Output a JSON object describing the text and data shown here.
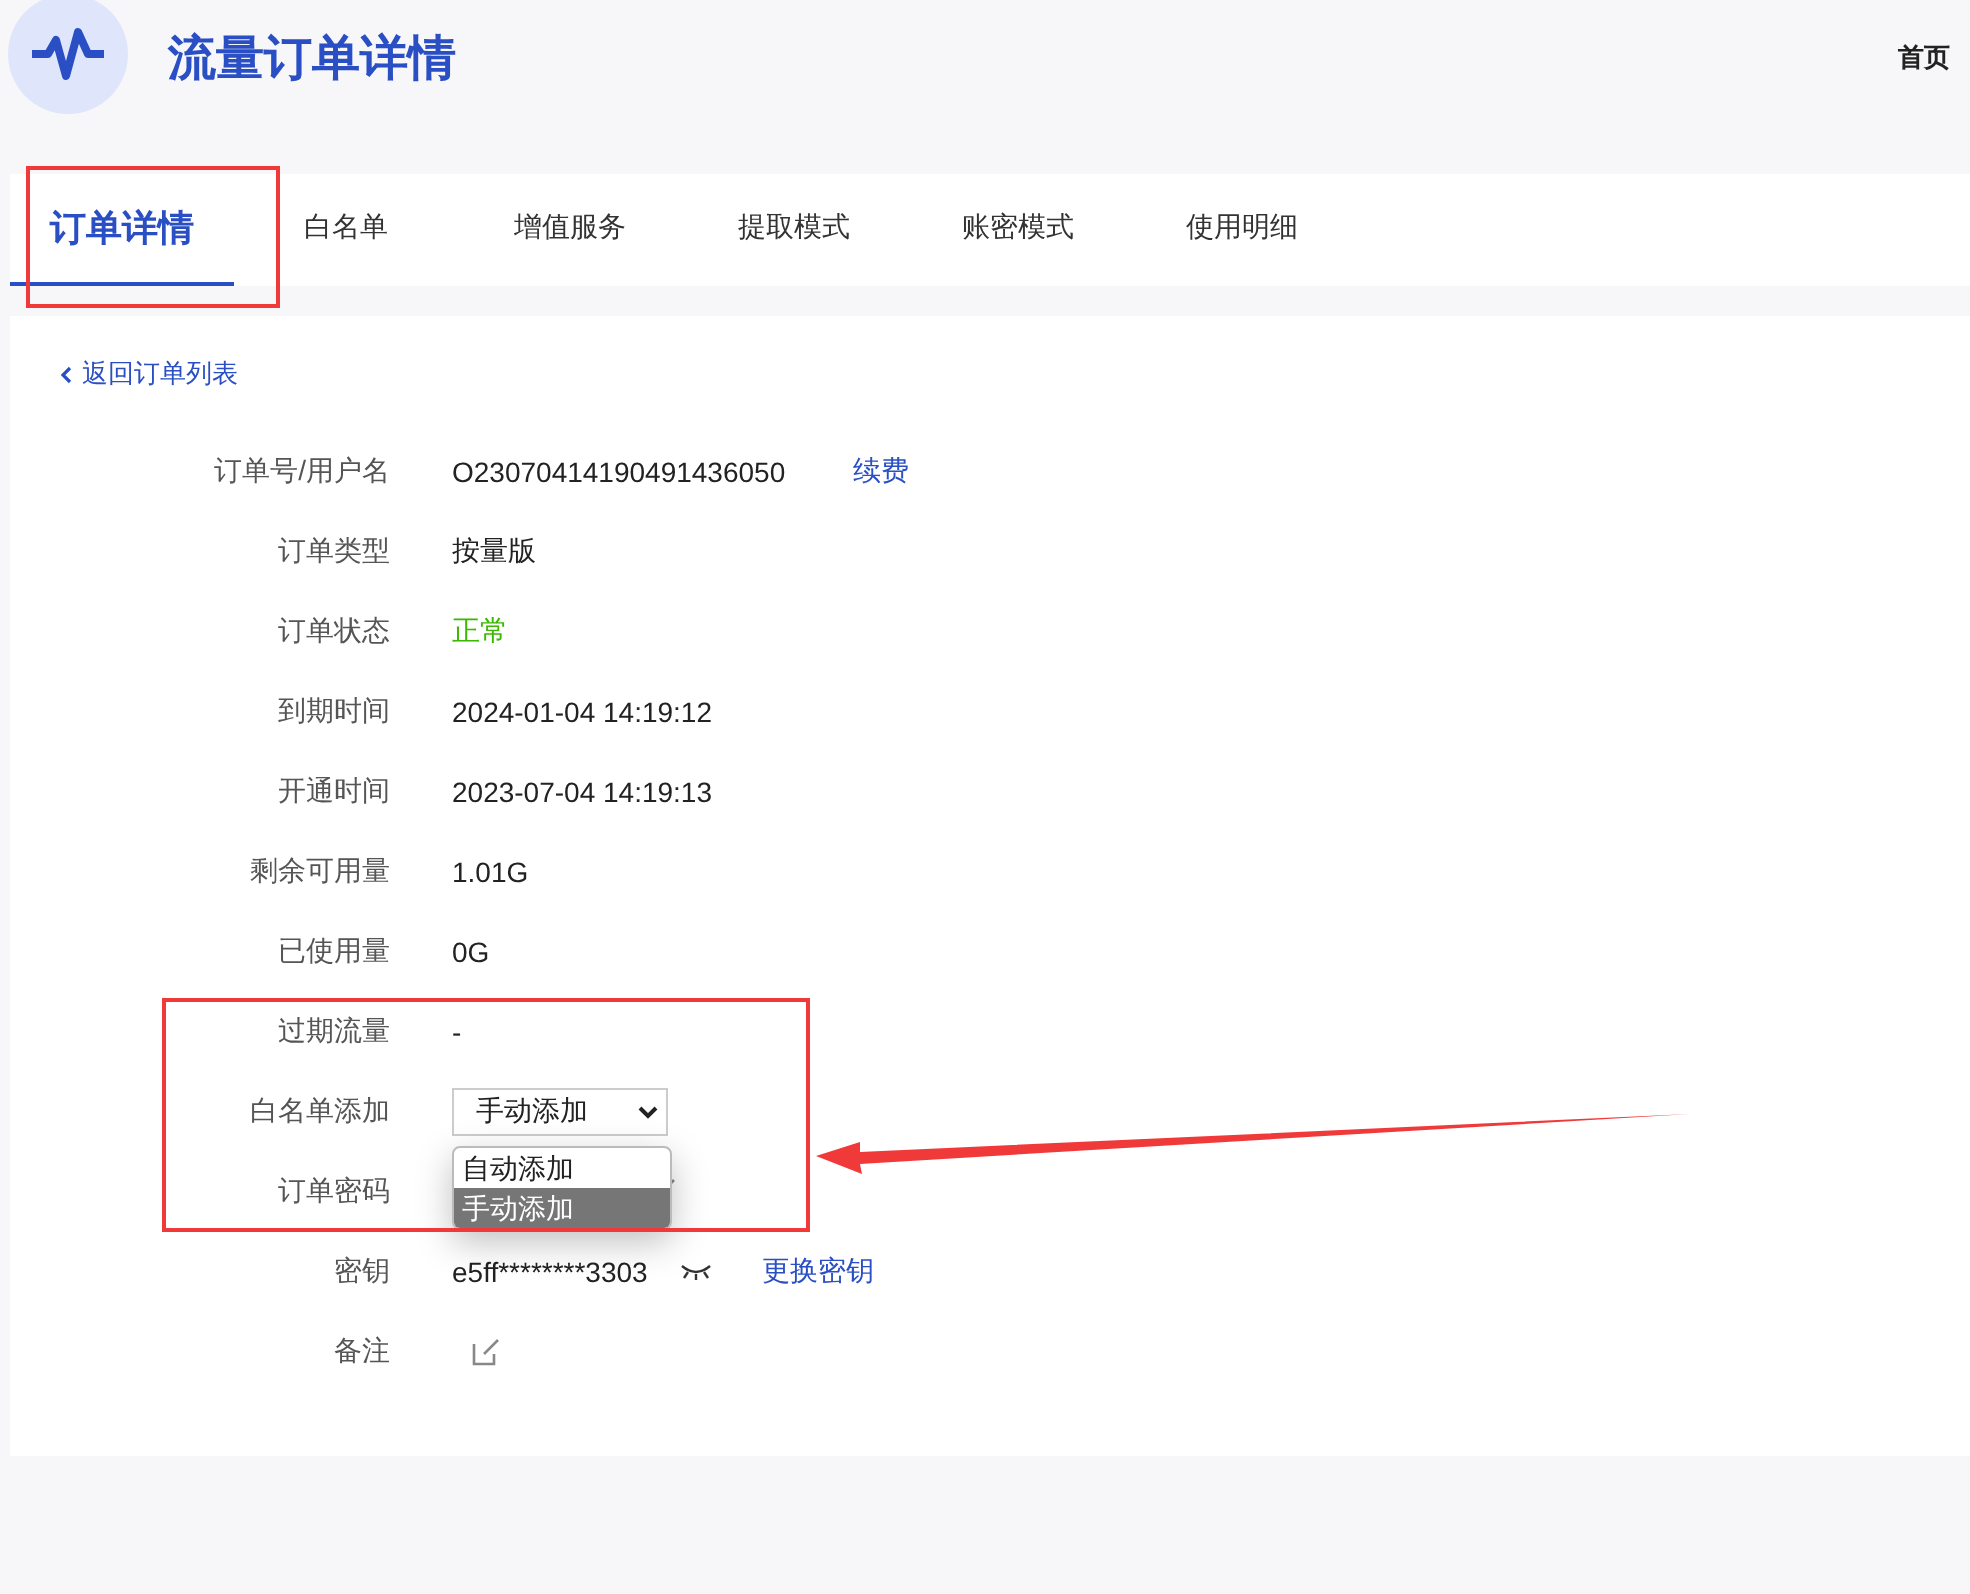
{
  "header": {
    "title": "流量订单详情",
    "home_link": "首页"
  },
  "tabs": [
    {
      "label": "订单详情",
      "selected": true
    },
    {
      "label": "白名单",
      "selected": false
    },
    {
      "label": "增值服务",
      "selected": false
    },
    {
      "label": "提取模式",
      "selected": false
    },
    {
      "label": "账密模式",
      "selected": false
    },
    {
      "label": "使用明细",
      "selected": false
    }
  ],
  "back_link": "返回订单列表",
  "fields": [
    {
      "label": "订单号/用户名",
      "kind": "text",
      "value": "O23070414190491436050",
      "link": "续费"
    },
    {
      "label": "订单类型",
      "kind": "text",
      "value": "按量版"
    },
    {
      "label": "订单状态",
      "kind": "status",
      "value": "正常"
    },
    {
      "label": "到期时间",
      "kind": "text",
      "value": "2024-01-04 14:19:12"
    },
    {
      "label": "开通时间",
      "kind": "text",
      "value": "2023-07-04 14:19:13"
    },
    {
      "label": "剩余可用量",
      "kind": "text",
      "value": "1.01G"
    },
    {
      "label": "已使用量",
      "kind": "text",
      "value": "0G"
    },
    {
      "label": "过期流量",
      "kind": "text",
      "value": "-"
    },
    {
      "label": "白名单添加",
      "kind": "select",
      "value": "手动添加",
      "expanded": true,
      "options": [
        {
          "label": "自动添加",
          "selected": false
        },
        {
          "label": "手动添加",
          "selected": true
        }
      ]
    },
    {
      "label": "订单密码",
      "kind": "hidden"
    },
    {
      "label": "密钥",
      "kind": "secret",
      "value": "e5ff********3303",
      "link": "更换密钥"
    },
    {
      "label": "备注",
      "kind": "note"
    }
  ]
}
